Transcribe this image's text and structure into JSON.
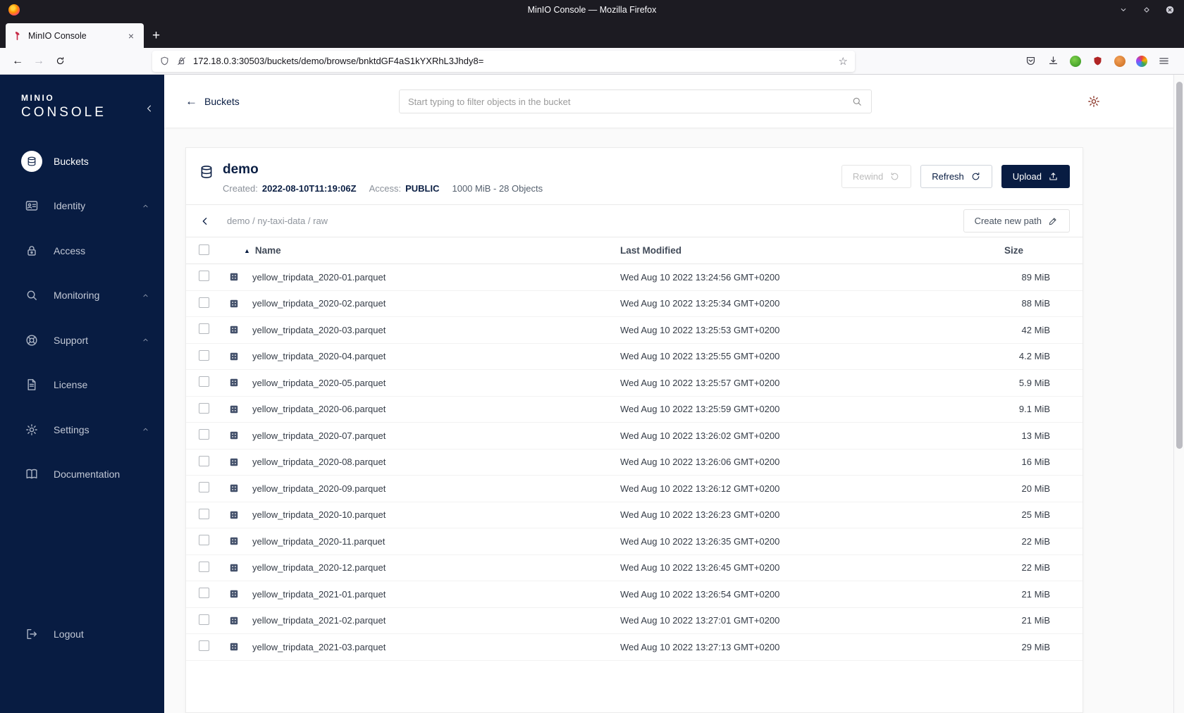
{
  "window": {
    "title": "MinIO Console — Mozilla Firefox"
  },
  "browser": {
    "tab_title": "MinIO Console",
    "url": "172.18.0.3:30503/buckets/demo/browse/bnktdGF4aS1kYXRhL3Jhdy8="
  },
  "glyphs": {
    "back_arrow": "←",
    "forward_arrow": "→",
    "new_tab": "+",
    "close_tab": "×",
    "star": "☆",
    "sort_asc": "▲"
  },
  "colors": {
    "sidebar": "#081c42",
    "primary": "#081c42",
    "brand_red": "#c72c48"
  },
  "sidebar": {
    "logo_top": "MINIO",
    "logo_bottom": "CONSOLE",
    "items": [
      {
        "label": "Buckets",
        "icon": "bucket",
        "active": true,
        "expandable": false
      },
      {
        "label": "Identity",
        "icon": "identity",
        "active": false,
        "expandable": true
      },
      {
        "label": "Access",
        "icon": "access",
        "active": false,
        "expandable": false
      },
      {
        "label": "Monitoring",
        "icon": "monitoring",
        "active": false,
        "expandable": true
      },
      {
        "label": "Support",
        "icon": "support",
        "active": false,
        "expandable": true
      },
      {
        "label": "License",
        "icon": "license",
        "active": false,
        "expandable": false
      },
      {
        "label": "Settings",
        "icon": "settings",
        "active": false,
        "expandable": true
      },
      {
        "label": "Documentation",
        "icon": "documentation",
        "active": false,
        "expandable": false
      }
    ],
    "logout_label": "Logout"
  },
  "topbar": {
    "back_label": "Buckets",
    "search_placeholder": "Start typing to filter objects in the bucket"
  },
  "bucket": {
    "name": "demo",
    "created_label": "Created:",
    "created_value": "2022-08-10T11:19:06Z",
    "access_label": "Access:",
    "access_value": "PUBLIC",
    "usage": "1000 MiB - 28 Objects",
    "buttons": {
      "rewind": "Rewind",
      "refresh": "Refresh",
      "upload": "Upload"
    }
  },
  "path": {
    "breadcrumb": "demo / ny-taxi-data / raw",
    "create_new_path": "Create new path"
  },
  "table": {
    "columns": [
      "Name",
      "Last Modified",
      "Size"
    ],
    "rows": [
      {
        "name": "yellow_tripdata_2020-01.parquet",
        "modified": "Wed Aug 10 2022 13:24:56 GMT+0200",
        "size": "89 MiB"
      },
      {
        "name": "yellow_tripdata_2020-02.parquet",
        "modified": "Wed Aug 10 2022 13:25:34 GMT+0200",
        "size": "88 MiB"
      },
      {
        "name": "yellow_tripdata_2020-03.parquet",
        "modified": "Wed Aug 10 2022 13:25:53 GMT+0200",
        "size": "42 MiB"
      },
      {
        "name": "yellow_tripdata_2020-04.parquet",
        "modified": "Wed Aug 10 2022 13:25:55 GMT+0200",
        "size": "4.2 MiB"
      },
      {
        "name": "yellow_tripdata_2020-05.parquet",
        "modified": "Wed Aug 10 2022 13:25:57 GMT+0200",
        "size": "5.9 MiB"
      },
      {
        "name": "yellow_tripdata_2020-06.parquet",
        "modified": "Wed Aug 10 2022 13:25:59 GMT+0200",
        "size": "9.1 MiB"
      },
      {
        "name": "yellow_tripdata_2020-07.parquet",
        "modified": "Wed Aug 10 2022 13:26:02 GMT+0200",
        "size": "13 MiB"
      },
      {
        "name": "yellow_tripdata_2020-08.parquet",
        "modified": "Wed Aug 10 2022 13:26:06 GMT+0200",
        "size": "16 MiB"
      },
      {
        "name": "yellow_tripdata_2020-09.parquet",
        "modified": "Wed Aug 10 2022 13:26:12 GMT+0200",
        "size": "20 MiB"
      },
      {
        "name": "yellow_tripdata_2020-10.parquet",
        "modified": "Wed Aug 10 2022 13:26:23 GMT+0200",
        "size": "25 MiB"
      },
      {
        "name": "yellow_tripdata_2020-11.parquet",
        "modified": "Wed Aug 10 2022 13:26:35 GMT+0200",
        "size": "22 MiB"
      },
      {
        "name": "yellow_tripdata_2020-12.parquet",
        "modified": "Wed Aug 10 2022 13:26:45 GMT+0200",
        "size": "22 MiB"
      },
      {
        "name": "yellow_tripdata_2021-01.parquet",
        "modified": "Wed Aug 10 2022 13:26:54 GMT+0200",
        "size": "21 MiB"
      },
      {
        "name": "yellow_tripdata_2021-02.parquet",
        "modified": "Wed Aug 10 2022 13:27:01 GMT+0200",
        "size": "21 MiB"
      },
      {
        "name": "yellow_tripdata_2021-03.parquet",
        "modified": "Wed Aug 10 2022 13:27:13 GMT+0200",
        "size": "29 MiB"
      }
    ]
  }
}
